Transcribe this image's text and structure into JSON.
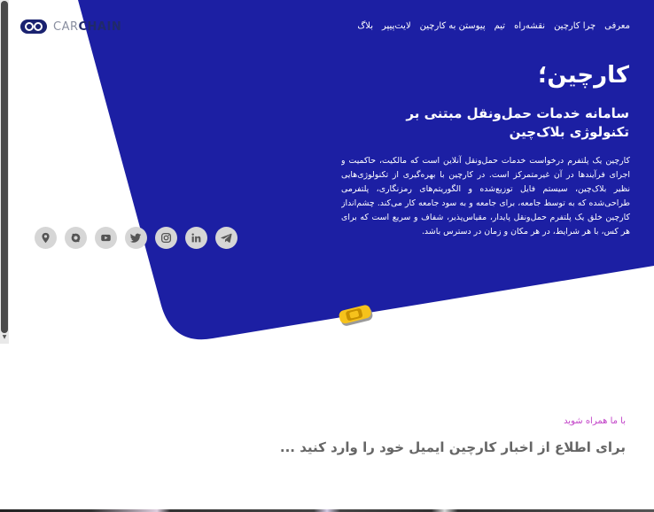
{
  "brand": {
    "logo_part1": "CAR",
    "logo_part2": "CHAIN"
  },
  "nav": {
    "items": [
      "معرفی",
      "چرا کارچین",
      "نقشه‌راه",
      "تیم",
      "پیوستن به کارچین",
      "لایت‌پیپر",
      "بلاگ"
    ]
  },
  "hero": {
    "title": "کارچین؛",
    "subtitle": "سامانه خدمات حمل‌ونقل مبتنی بر تکنولوژی بلاک‌چین",
    "description": "کارچین یک پلتفرم درخواست خدمات حمل‌ونقل آنلاین است که مالکیت، حاکمیت و اجرای فرآیندها در آن غیرمتمرکز است. در کارچین با بهره‌گیری از تکنولوژی‌هایی نظیر بلاک‌چین، سیستم فایل توزیع‌شده و الگوریتم‌های رمزنگاری، پلتفرمی طراحی‌شده که به توسط جامعه، برای جامعه و به سود جامعه کار می‌کند. چشم‌انداز کارچین خلق یک پلتفرم حمل‌ونقل پایدار، مقیاس‌پذیر، شفاف و سریع است که برای هر کس، با هر شرایط، در هر مکان و زمان در دسترس باشد."
  },
  "socials": [
    "telegram-icon",
    "linkedin-icon",
    "instagram-icon",
    "twitter-icon",
    "youtube-icon",
    "aparat-icon",
    "location-icon"
  ],
  "join": {
    "kicker": "با ما همراه شوید",
    "title": "برای اطلاع از اخبار کارچین ایمیل خود را وارد کنید ..."
  },
  "colors": {
    "hero_blue": "#1c1fa3",
    "accent_purple": "#c243c8",
    "car_yellow": "#f6c21c",
    "social_grey": "#d6d6d6"
  }
}
